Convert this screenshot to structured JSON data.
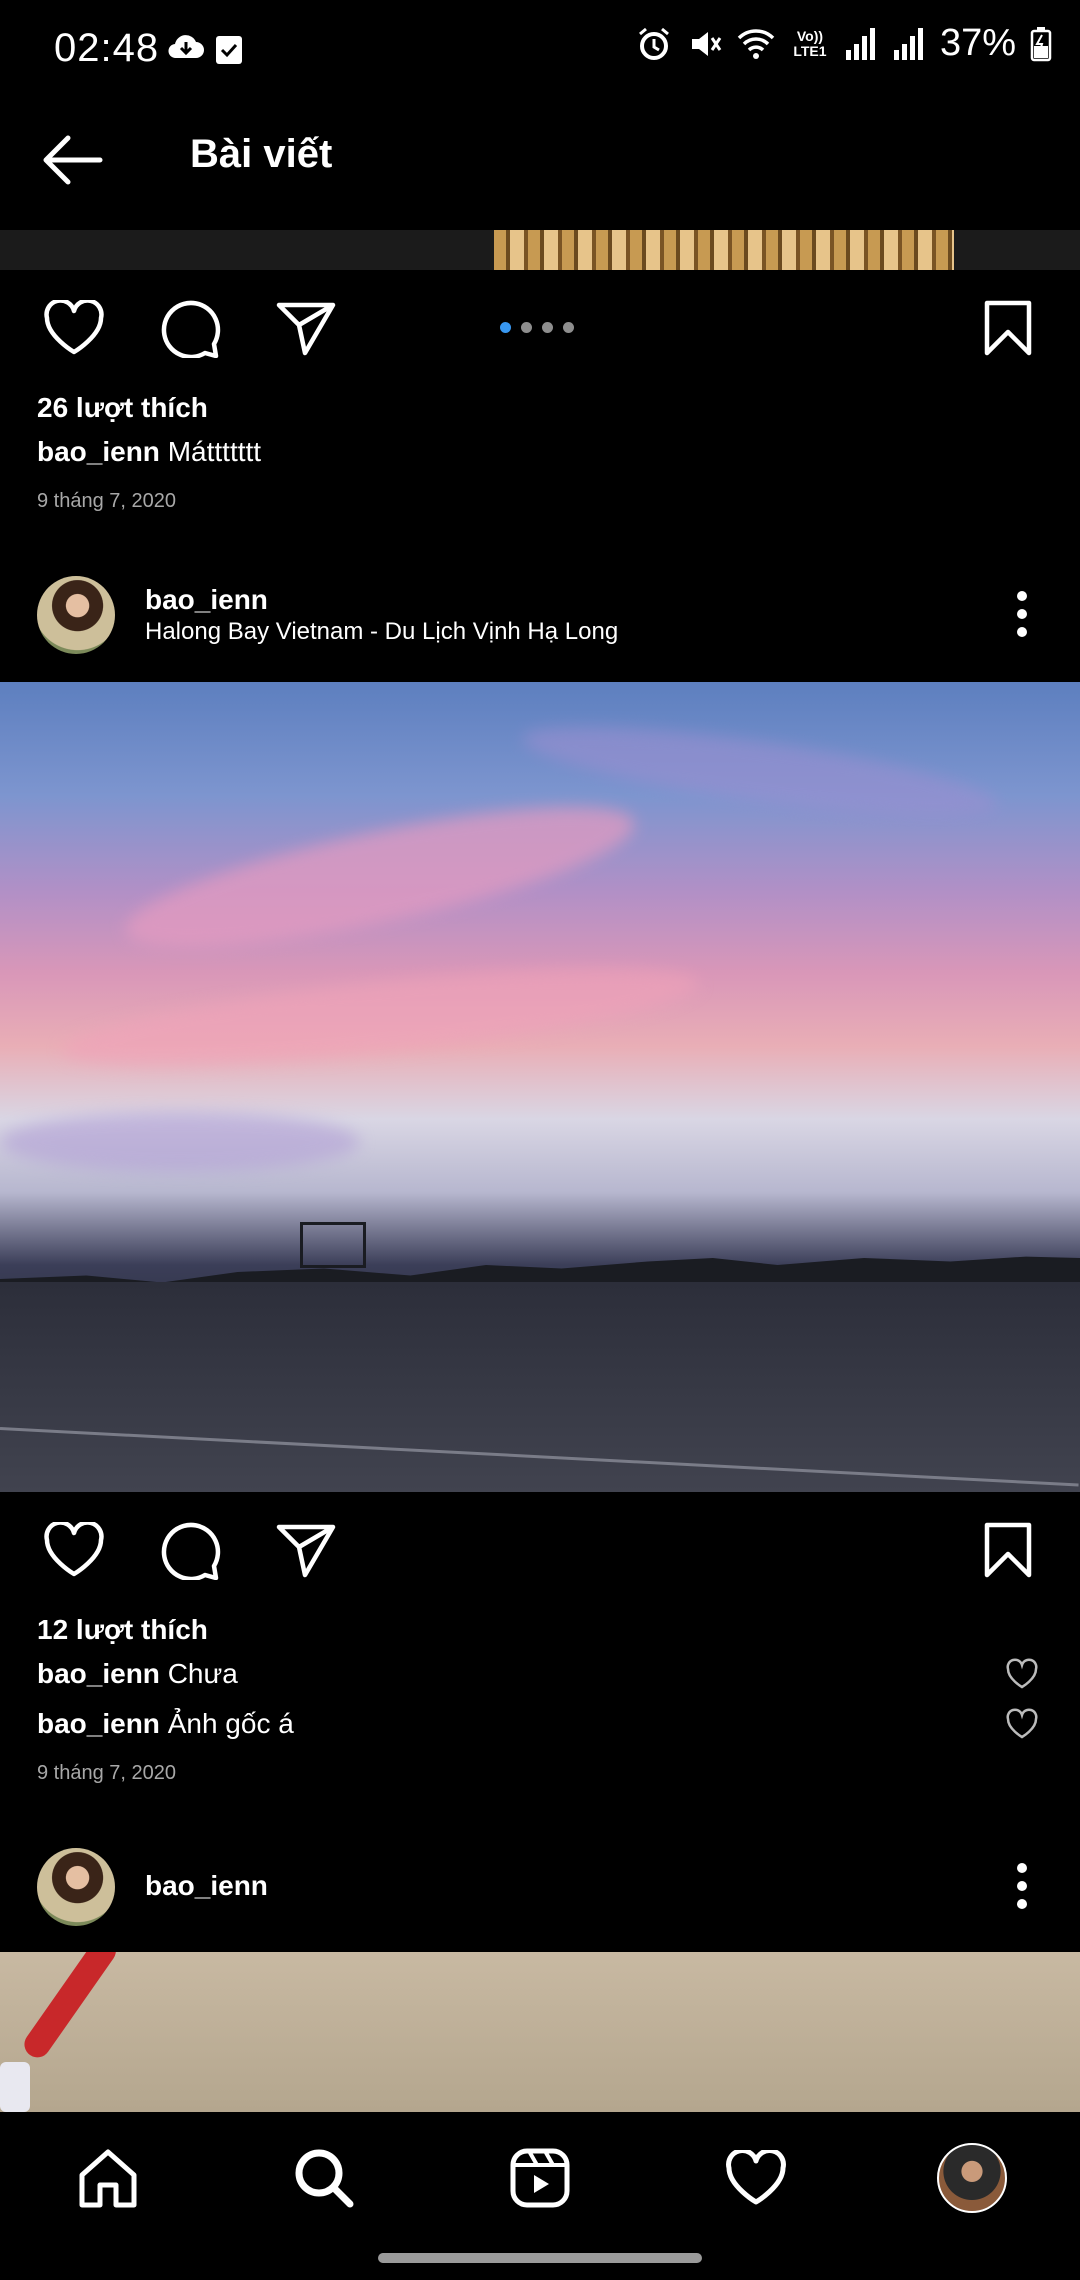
{
  "status_bar": {
    "time": "02:48",
    "battery": "37%",
    "icons": [
      "cloud-icon",
      "check-square-icon",
      "alarm-icon",
      "mute-icon",
      "wifi-icon",
      "volte-icon",
      "signal-icon",
      "signal-icon",
      "battery-icon"
    ],
    "volte_label": "Vo)) LTE1"
  },
  "header": {
    "title": "Bài viết"
  },
  "post1": {
    "likes": "26 lượt thích",
    "caption_user": "bao_ienn",
    "caption_text": "Máttttttt",
    "date": "9 tháng 7, 2020",
    "carousel_total": 4,
    "carousel_active": 1
  },
  "post2": {
    "username": "bao_ienn",
    "location": "Halong Bay Vietnam - Du Lịch Vịnh Hạ Long",
    "likes": "12 lượt thích",
    "comments": [
      {
        "user": "bao_ienn",
        "text": "Chưa"
      },
      {
        "user": "bao_ienn",
        "text": "Ảnh gốc á"
      }
    ],
    "date": "9 tháng 7, 2020"
  },
  "post3": {
    "username": "bao_ienn"
  },
  "bottom_nav": {
    "items": [
      "home-icon",
      "search-icon",
      "reels-icon",
      "heart-icon",
      "profile-avatar"
    ],
    "active": "search-icon"
  },
  "colors": {
    "background": "#000000",
    "accent": "#3897f0",
    "secondary_text": "#a8a8a8"
  }
}
